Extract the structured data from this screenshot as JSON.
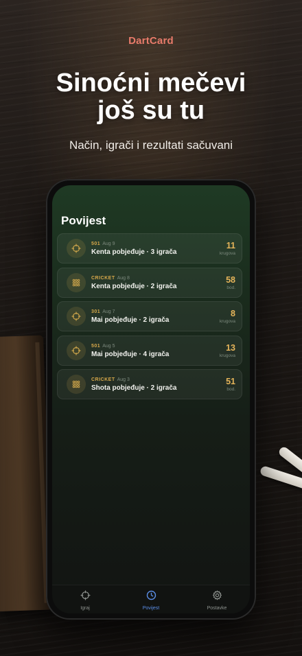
{
  "brand": "DartCard",
  "headline": {
    "line1": "Sinoćni mečevi",
    "line2": "još su tu"
  },
  "subtitle": "Način, igrači i rezultati sačuvani",
  "screen": {
    "title": "Povijest",
    "matches": [
      {
        "mode": "501",
        "date": "Aug 9",
        "summary": "Kenta pobjeđuje · 3 igrača",
        "score": "11",
        "unit": "krugova",
        "icon": "crosshair-icon"
      },
      {
        "mode": "CRICKET",
        "date": "Aug 8",
        "summary": "Kenta pobjeđuje · 2 igrača",
        "score": "58",
        "unit": "bod.",
        "icon": "grid-icon"
      },
      {
        "mode": "301",
        "date": "Aug 7",
        "summary": "Mai pobjeđuje · 2 igrača",
        "score": "8",
        "unit": "krugova",
        "icon": "crosshair-icon"
      },
      {
        "mode": "501",
        "date": "Aug 5",
        "summary": "Mai pobjeđuje · 4 igrača",
        "score": "13",
        "unit": "krugova",
        "icon": "crosshair-icon"
      },
      {
        "mode": "CRICKET",
        "date": "Aug 3",
        "summary": "Shota pobjeđuje · 2 igrača",
        "score": "51",
        "unit": "bod.",
        "icon": "grid-icon"
      }
    ],
    "tabs": [
      {
        "label": "Igraj",
        "icon": "crosshair-icon",
        "active": false
      },
      {
        "label": "Povijest",
        "icon": "clock-icon",
        "active": true
      },
      {
        "label": "Postavke",
        "icon": "gear-icon",
        "active": false
      }
    ]
  },
  "colors": {
    "brand": "#e87b6a",
    "accent_gold": "#e6b55a",
    "tab_active": "#5b8ee6"
  }
}
